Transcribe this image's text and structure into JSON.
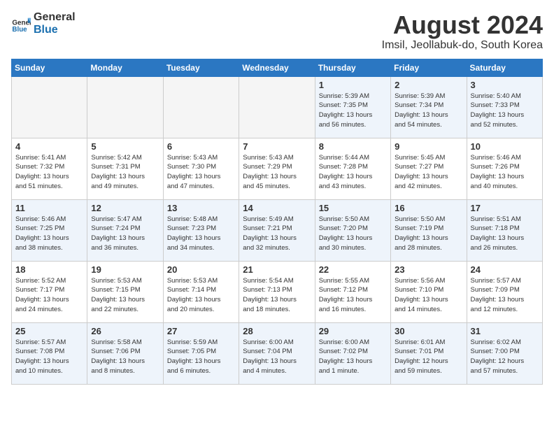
{
  "header": {
    "logo_general": "General",
    "logo_blue": "Blue",
    "month_title": "August 2024",
    "location": "Imsil, Jeollabuk-do, South Korea"
  },
  "days_of_week": [
    "Sunday",
    "Monday",
    "Tuesday",
    "Wednesday",
    "Thursday",
    "Friday",
    "Saturday"
  ],
  "weeks": [
    [
      {
        "day": "",
        "info": "",
        "empty": true
      },
      {
        "day": "",
        "info": "",
        "empty": true
      },
      {
        "day": "",
        "info": "",
        "empty": true
      },
      {
        "day": "",
        "info": "",
        "empty": true
      },
      {
        "day": "1",
        "info": "Sunrise: 5:39 AM\nSunset: 7:35 PM\nDaylight: 13 hours\nand 56 minutes."
      },
      {
        "day": "2",
        "info": "Sunrise: 5:39 AM\nSunset: 7:34 PM\nDaylight: 13 hours\nand 54 minutes."
      },
      {
        "day": "3",
        "info": "Sunrise: 5:40 AM\nSunset: 7:33 PM\nDaylight: 13 hours\nand 52 minutes."
      }
    ],
    [
      {
        "day": "4",
        "info": "Sunrise: 5:41 AM\nSunset: 7:32 PM\nDaylight: 13 hours\nand 51 minutes."
      },
      {
        "day": "5",
        "info": "Sunrise: 5:42 AM\nSunset: 7:31 PM\nDaylight: 13 hours\nand 49 minutes."
      },
      {
        "day": "6",
        "info": "Sunrise: 5:43 AM\nSunset: 7:30 PM\nDaylight: 13 hours\nand 47 minutes."
      },
      {
        "day": "7",
        "info": "Sunrise: 5:43 AM\nSunset: 7:29 PM\nDaylight: 13 hours\nand 45 minutes."
      },
      {
        "day": "8",
        "info": "Sunrise: 5:44 AM\nSunset: 7:28 PM\nDaylight: 13 hours\nand 43 minutes."
      },
      {
        "day": "9",
        "info": "Sunrise: 5:45 AM\nSunset: 7:27 PM\nDaylight: 13 hours\nand 42 minutes."
      },
      {
        "day": "10",
        "info": "Sunrise: 5:46 AM\nSunset: 7:26 PM\nDaylight: 13 hours\nand 40 minutes."
      }
    ],
    [
      {
        "day": "11",
        "info": "Sunrise: 5:46 AM\nSunset: 7:25 PM\nDaylight: 13 hours\nand 38 minutes."
      },
      {
        "day": "12",
        "info": "Sunrise: 5:47 AM\nSunset: 7:24 PM\nDaylight: 13 hours\nand 36 minutes."
      },
      {
        "day": "13",
        "info": "Sunrise: 5:48 AM\nSunset: 7:23 PM\nDaylight: 13 hours\nand 34 minutes."
      },
      {
        "day": "14",
        "info": "Sunrise: 5:49 AM\nSunset: 7:21 PM\nDaylight: 13 hours\nand 32 minutes."
      },
      {
        "day": "15",
        "info": "Sunrise: 5:50 AM\nSunset: 7:20 PM\nDaylight: 13 hours\nand 30 minutes."
      },
      {
        "day": "16",
        "info": "Sunrise: 5:50 AM\nSunset: 7:19 PM\nDaylight: 13 hours\nand 28 minutes."
      },
      {
        "day": "17",
        "info": "Sunrise: 5:51 AM\nSunset: 7:18 PM\nDaylight: 13 hours\nand 26 minutes."
      }
    ],
    [
      {
        "day": "18",
        "info": "Sunrise: 5:52 AM\nSunset: 7:17 PM\nDaylight: 13 hours\nand 24 minutes."
      },
      {
        "day": "19",
        "info": "Sunrise: 5:53 AM\nSunset: 7:15 PM\nDaylight: 13 hours\nand 22 minutes."
      },
      {
        "day": "20",
        "info": "Sunrise: 5:53 AM\nSunset: 7:14 PM\nDaylight: 13 hours\nand 20 minutes."
      },
      {
        "day": "21",
        "info": "Sunrise: 5:54 AM\nSunset: 7:13 PM\nDaylight: 13 hours\nand 18 minutes."
      },
      {
        "day": "22",
        "info": "Sunrise: 5:55 AM\nSunset: 7:12 PM\nDaylight: 13 hours\nand 16 minutes."
      },
      {
        "day": "23",
        "info": "Sunrise: 5:56 AM\nSunset: 7:10 PM\nDaylight: 13 hours\nand 14 minutes."
      },
      {
        "day": "24",
        "info": "Sunrise: 5:57 AM\nSunset: 7:09 PM\nDaylight: 13 hours\nand 12 minutes."
      }
    ],
    [
      {
        "day": "25",
        "info": "Sunrise: 5:57 AM\nSunset: 7:08 PM\nDaylight: 13 hours\nand 10 minutes."
      },
      {
        "day": "26",
        "info": "Sunrise: 5:58 AM\nSunset: 7:06 PM\nDaylight: 13 hours\nand 8 minutes."
      },
      {
        "day": "27",
        "info": "Sunrise: 5:59 AM\nSunset: 7:05 PM\nDaylight: 13 hours\nand 6 minutes."
      },
      {
        "day": "28",
        "info": "Sunrise: 6:00 AM\nSunset: 7:04 PM\nDaylight: 13 hours\nand 4 minutes."
      },
      {
        "day": "29",
        "info": "Sunrise: 6:00 AM\nSunset: 7:02 PM\nDaylight: 13 hours\nand 1 minute."
      },
      {
        "day": "30",
        "info": "Sunrise: 6:01 AM\nSunset: 7:01 PM\nDaylight: 12 hours\nand 59 minutes."
      },
      {
        "day": "31",
        "info": "Sunrise: 6:02 AM\nSunset: 7:00 PM\nDaylight: 12 hours\nand 57 minutes."
      }
    ]
  ]
}
